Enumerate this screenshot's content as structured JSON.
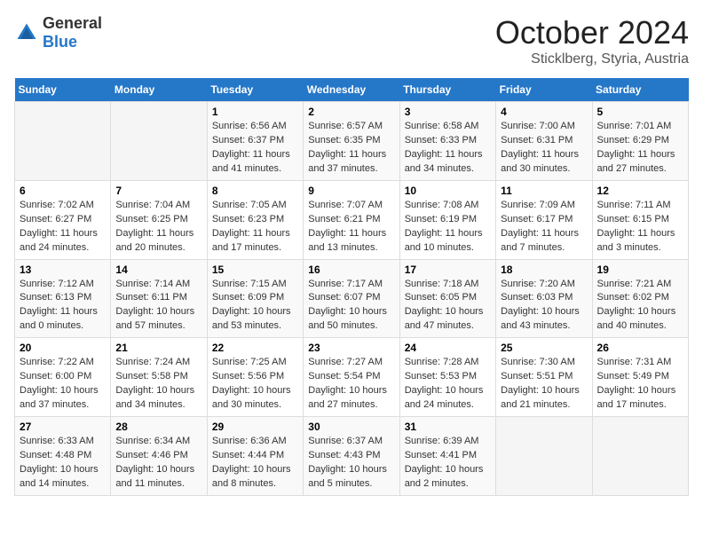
{
  "header": {
    "logo_general": "General",
    "logo_blue": "Blue",
    "title": "October 2024",
    "location": "Sticklberg, Styria, Austria"
  },
  "weekdays": [
    "Sunday",
    "Monday",
    "Tuesday",
    "Wednesday",
    "Thursday",
    "Friday",
    "Saturday"
  ],
  "weeks": [
    [
      {
        "day": "",
        "content": ""
      },
      {
        "day": "",
        "content": ""
      },
      {
        "day": "1",
        "content": "Sunrise: 6:56 AM\nSunset: 6:37 PM\nDaylight: 11 hours and 41 minutes."
      },
      {
        "day": "2",
        "content": "Sunrise: 6:57 AM\nSunset: 6:35 PM\nDaylight: 11 hours and 37 minutes."
      },
      {
        "day": "3",
        "content": "Sunrise: 6:58 AM\nSunset: 6:33 PM\nDaylight: 11 hours and 34 minutes."
      },
      {
        "day": "4",
        "content": "Sunrise: 7:00 AM\nSunset: 6:31 PM\nDaylight: 11 hours and 30 minutes."
      },
      {
        "day": "5",
        "content": "Sunrise: 7:01 AM\nSunset: 6:29 PM\nDaylight: 11 hours and 27 minutes."
      }
    ],
    [
      {
        "day": "6",
        "content": "Sunrise: 7:02 AM\nSunset: 6:27 PM\nDaylight: 11 hours and 24 minutes."
      },
      {
        "day": "7",
        "content": "Sunrise: 7:04 AM\nSunset: 6:25 PM\nDaylight: 11 hours and 20 minutes."
      },
      {
        "day": "8",
        "content": "Sunrise: 7:05 AM\nSunset: 6:23 PM\nDaylight: 11 hours and 17 minutes."
      },
      {
        "day": "9",
        "content": "Sunrise: 7:07 AM\nSunset: 6:21 PM\nDaylight: 11 hours and 13 minutes."
      },
      {
        "day": "10",
        "content": "Sunrise: 7:08 AM\nSunset: 6:19 PM\nDaylight: 11 hours and 10 minutes."
      },
      {
        "day": "11",
        "content": "Sunrise: 7:09 AM\nSunset: 6:17 PM\nDaylight: 11 hours and 7 minutes."
      },
      {
        "day": "12",
        "content": "Sunrise: 7:11 AM\nSunset: 6:15 PM\nDaylight: 11 hours and 3 minutes."
      }
    ],
    [
      {
        "day": "13",
        "content": "Sunrise: 7:12 AM\nSunset: 6:13 PM\nDaylight: 11 hours and 0 minutes."
      },
      {
        "day": "14",
        "content": "Sunrise: 7:14 AM\nSunset: 6:11 PM\nDaylight: 10 hours and 57 minutes."
      },
      {
        "day": "15",
        "content": "Sunrise: 7:15 AM\nSunset: 6:09 PM\nDaylight: 10 hours and 53 minutes."
      },
      {
        "day": "16",
        "content": "Sunrise: 7:17 AM\nSunset: 6:07 PM\nDaylight: 10 hours and 50 minutes."
      },
      {
        "day": "17",
        "content": "Sunrise: 7:18 AM\nSunset: 6:05 PM\nDaylight: 10 hours and 47 minutes."
      },
      {
        "day": "18",
        "content": "Sunrise: 7:20 AM\nSunset: 6:03 PM\nDaylight: 10 hours and 43 minutes."
      },
      {
        "day": "19",
        "content": "Sunrise: 7:21 AM\nSunset: 6:02 PM\nDaylight: 10 hours and 40 minutes."
      }
    ],
    [
      {
        "day": "20",
        "content": "Sunrise: 7:22 AM\nSunset: 6:00 PM\nDaylight: 10 hours and 37 minutes."
      },
      {
        "day": "21",
        "content": "Sunrise: 7:24 AM\nSunset: 5:58 PM\nDaylight: 10 hours and 34 minutes."
      },
      {
        "day": "22",
        "content": "Sunrise: 7:25 AM\nSunset: 5:56 PM\nDaylight: 10 hours and 30 minutes."
      },
      {
        "day": "23",
        "content": "Sunrise: 7:27 AM\nSunset: 5:54 PM\nDaylight: 10 hours and 27 minutes."
      },
      {
        "day": "24",
        "content": "Sunrise: 7:28 AM\nSunset: 5:53 PM\nDaylight: 10 hours and 24 minutes."
      },
      {
        "day": "25",
        "content": "Sunrise: 7:30 AM\nSunset: 5:51 PM\nDaylight: 10 hours and 21 minutes."
      },
      {
        "day": "26",
        "content": "Sunrise: 7:31 AM\nSunset: 5:49 PM\nDaylight: 10 hours and 17 minutes."
      }
    ],
    [
      {
        "day": "27",
        "content": "Sunrise: 6:33 AM\nSunset: 4:48 PM\nDaylight: 10 hours and 14 minutes."
      },
      {
        "day": "28",
        "content": "Sunrise: 6:34 AM\nSunset: 4:46 PM\nDaylight: 10 hours and 11 minutes."
      },
      {
        "day": "29",
        "content": "Sunrise: 6:36 AM\nSunset: 4:44 PM\nDaylight: 10 hours and 8 minutes."
      },
      {
        "day": "30",
        "content": "Sunrise: 6:37 AM\nSunset: 4:43 PM\nDaylight: 10 hours and 5 minutes."
      },
      {
        "day": "31",
        "content": "Sunrise: 6:39 AM\nSunset: 4:41 PM\nDaylight: 10 hours and 2 minutes."
      },
      {
        "day": "",
        "content": ""
      },
      {
        "day": "",
        "content": ""
      }
    ]
  ]
}
